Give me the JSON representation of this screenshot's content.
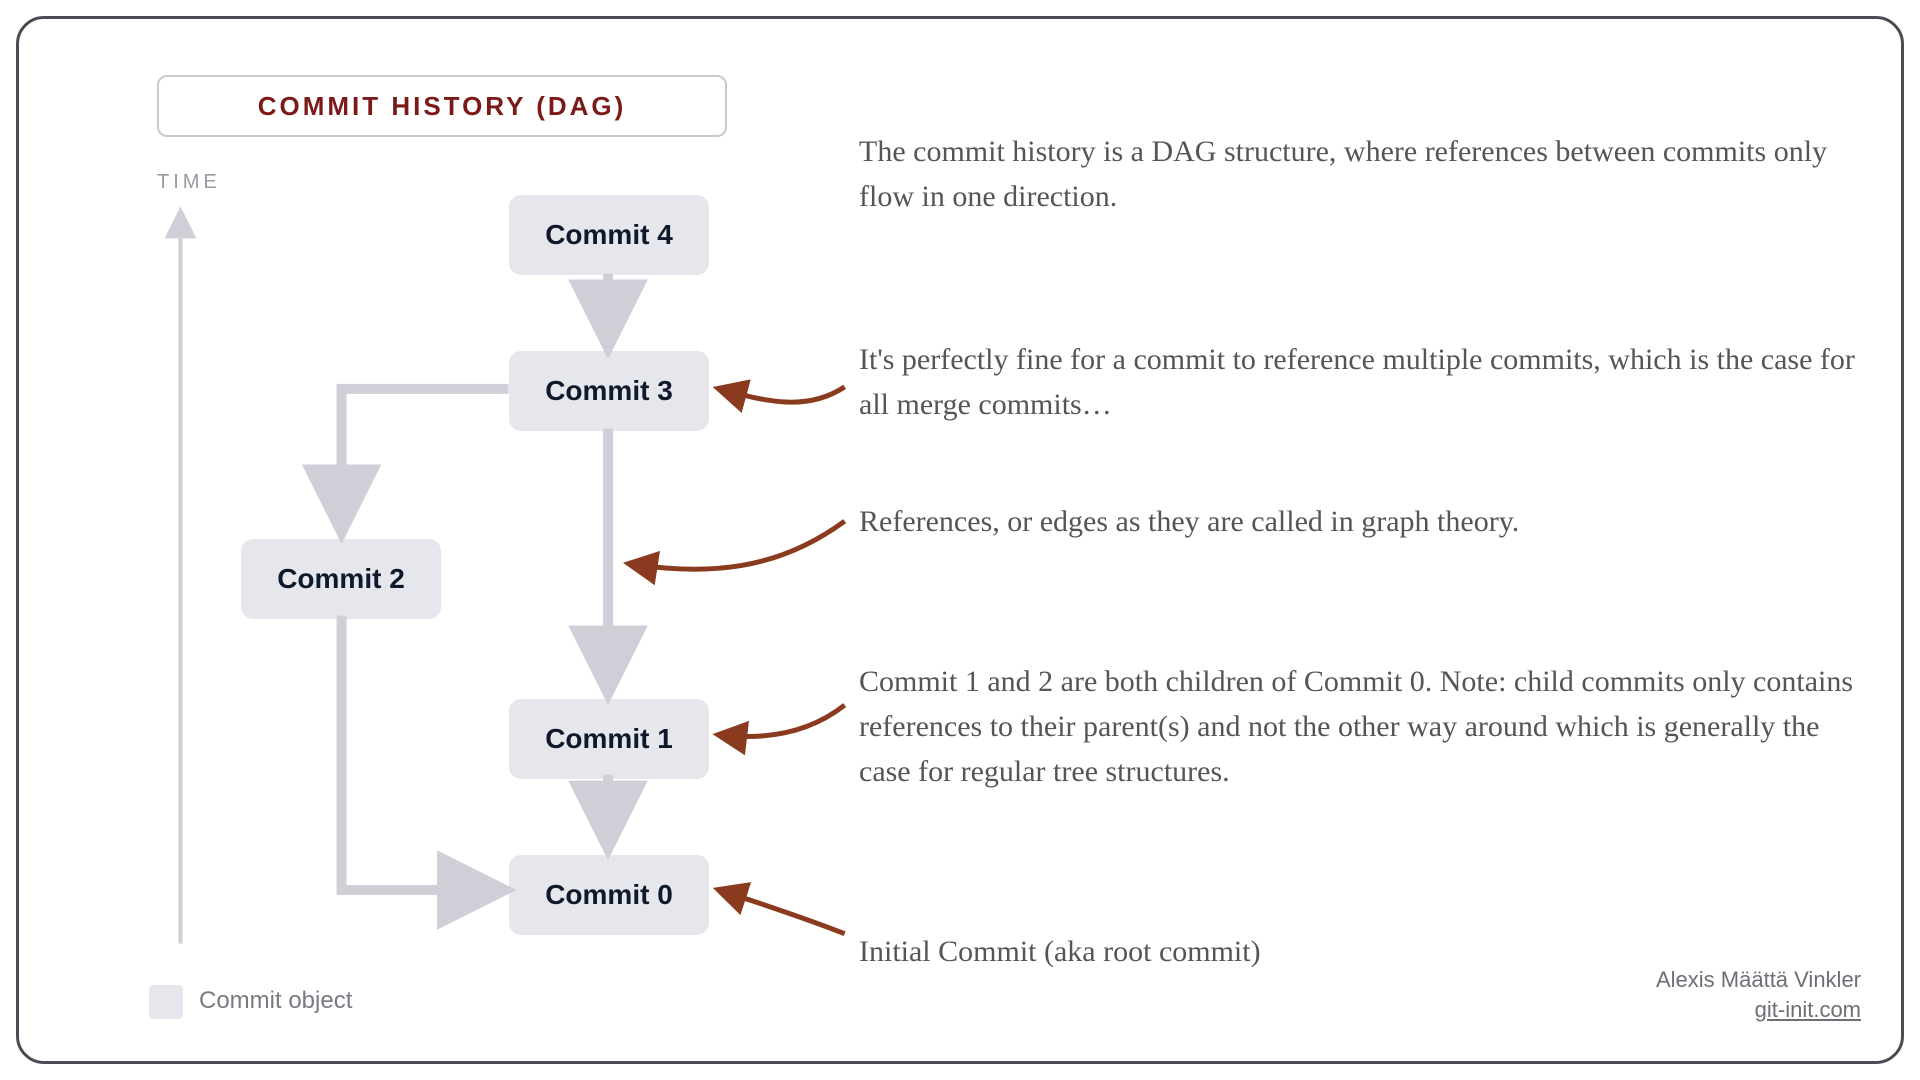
{
  "title": "COMMIT HISTORY (DAG)",
  "time_label": "TIME",
  "commits": {
    "c4": "Commit 4",
    "c3": "Commit 3",
    "c2": "Commit 2",
    "c1": "Commit 1",
    "c0": "Commit 0"
  },
  "legend": "Commit object",
  "annotations": {
    "a1": "The commit history is a DAG structure, where references between commits only flow in one direction.",
    "a2": "It's perfectly fine for a commit to reference multiple commits, which is the case for all merge commits…",
    "a3": "References, or edges as they are called in graph theory.",
    "a4": "Commit 1 and 2 are both children of Commit 0. Note: child commits only contains references to their parent(s) and not the other way around which is generally the case for regular tree structures.",
    "a5": "Initial Commit (aka root commit)"
  },
  "credit": {
    "author": "Alexis Määttä Vinkler",
    "site": "git-init.com"
  },
  "colors": {
    "node_bg": "#e6e6ed",
    "arrow_gray": "#cfcfd7",
    "arrow_brown": "#8a3b1f",
    "title_text": "#7c1a1a"
  }
}
